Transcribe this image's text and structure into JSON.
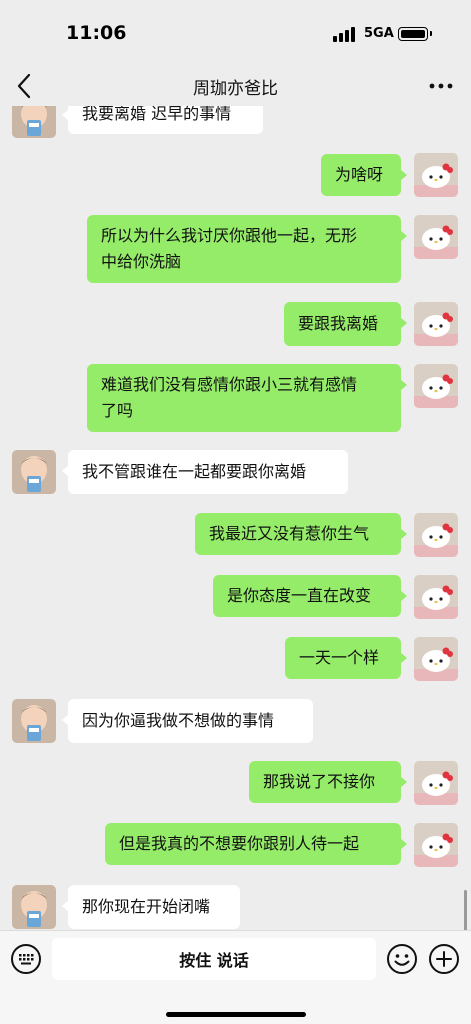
{
  "status": {
    "time": "11:06",
    "network": "5GA"
  },
  "nav": {
    "title": "周珈亦爸比"
  },
  "messages": [
    {
      "side": "left",
      "text": "我要离婚 迟早的事情"
    },
    {
      "side": "right",
      "text": "为啥呀"
    },
    {
      "side": "right",
      "text": "所以为什么我讨厌你跟他一起，无形中给你洗脑",
      "line1": "所以为什么我讨厌你跟他一起，无形",
      "line2": "中给你洗脑"
    },
    {
      "side": "right",
      "text": "要跟我离婚"
    },
    {
      "side": "right",
      "text": "难道我们没有感情你跟小三就有感情了吗",
      "line1": "难道我们没有感情你跟小三就有感情",
      "line2": "了吗"
    },
    {
      "side": "left",
      "text": "我不管跟谁在一起都要跟你离婚"
    },
    {
      "side": "right",
      "text": "我最近又没有惹你生气"
    },
    {
      "side": "right",
      "text": "是你态度一直在改变"
    },
    {
      "side": "right",
      "text": "一天一个样"
    },
    {
      "side": "left",
      "text": "因为你逼我做不想做的事情"
    },
    {
      "side": "right",
      "text": "那我说了不接你"
    },
    {
      "side": "right",
      "text": "但是我真的不想要你跟别人待一起"
    },
    {
      "side": "left",
      "text": "那你现在开始闭嘴"
    }
  ],
  "input": {
    "hold_to_talk": "按住 说话"
  },
  "icons": {
    "back": "chevron-left-icon",
    "more": "more-icon",
    "voice": "voice-keyboard-icon",
    "emoji": "emoji-icon",
    "plus": "plus-icon"
  },
  "colors": {
    "bubble_self": "#95ec69",
    "bubble_other": "#ffffff",
    "background": "#ededed"
  }
}
